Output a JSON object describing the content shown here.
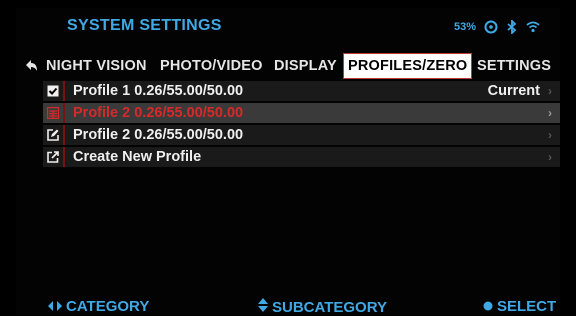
{
  "header": {
    "title": "SYSTEM SETTINGS",
    "battery": "53%"
  },
  "status_icons": [
    "battery-icon",
    "signal-icon",
    "bluetooth-icon",
    "wifi-icon"
  ],
  "tabs": [
    {
      "label": "NIGHT VISION"
    },
    {
      "label": "PHOTO/VIDEO"
    },
    {
      "label": "DISPLAY"
    },
    {
      "label": "PROFILES/ZERO",
      "active": true
    },
    {
      "label": "SETTINGS"
    }
  ],
  "profiles": [
    {
      "icon": "checked-box-icon",
      "label": "Profile 1 0.26/55.00/50.00",
      "right": "Current"
    },
    {
      "icon": "trash-icon",
      "label": "Profile 2 0.26/55.00/50.00",
      "selected": true
    },
    {
      "icon": "edit-icon",
      "label": "Profile 2 0.26/55.00/50.00"
    },
    {
      "icon": "external-link-icon",
      "label": "Create New Profile"
    }
  ],
  "footer": {
    "category": "CATEGORY",
    "subcategory": "SUBCATEGORY",
    "select": "SELECT"
  },
  "colors": {
    "accent": "#3fa9e6",
    "highlight": "#d62a2a"
  }
}
